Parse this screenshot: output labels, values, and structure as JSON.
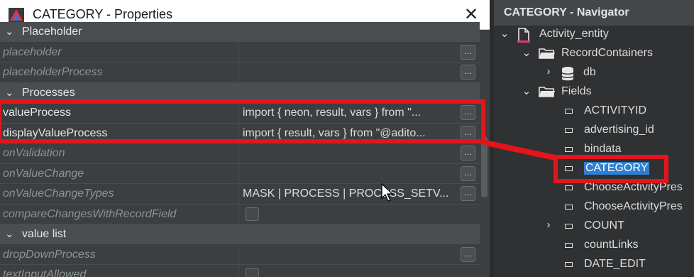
{
  "dialog": {
    "title": "CATEGORY - Properties",
    "close_glyph": "✕",
    "rows": [
      {
        "kind": "category",
        "label": "Placeholder",
        "expanded": true
      },
      {
        "kind": "prop",
        "name": "placeholder",
        "value": "",
        "button": true
      },
      {
        "kind": "prop",
        "name": "placeholderProcess",
        "value": "",
        "button": true
      },
      {
        "kind": "category",
        "label": "Processes",
        "expanded": true
      },
      {
        "kind": "prop",
        "name": "valueProcess",
        "value": "import { neon, result, vars } from \"...",
        "button": true,
        "set": true
      },
      {
        "kind": "prop",
        "name": "displayValueProcess",
        "value": "import { result, vars } from \"@adito...",
        "button": true,
        "set": true
      },
      {
        "kind": "prop",
        "name": "onValidation",
        "value": "",
        "button": true
      },
      {
        "kind": "prop",
        "name": "onValueChange",
        "value": "",
        "button": true
      },
      {
        "kind": "prop",
        "name": "onValueChangeTypes",
        "value": "MASK | PROCESS | PROCESS_SETV...",
        "button": true
      },
      {
        "kind": "prop",
        "name": "compareChangesWithRecordField",
        "value": "",
        "checkbox": true
      },
      {
        "kind": "category",
        "label": "value list",
        "expanded": true
      },
      {
        "kind": "prop",
        "name": "dropDownProcess",
        "value": "",
        "button": true
      },
      {
        "kind": "prop",
        "name": "textInputAllowed",
        "value": "",
        "checkbox": true
      }
    ],
    "button_label": "...",
    "icon_name": "app-logo-icon"
  },
  "navigator": {
    "title": "CATEGORY - Navigator",
    "nodes": [
      {
        "label": "Activity_entity",
        "level": 0,
        "twisty": "open",
        "icon": "entity-file-icon"
      },
      {
        "label": "RecordContainers",
        "level": 1,
        "twisty": "open",
        "icon": "folder-icon"
      },
      {
        "label": "db",
        "level": 2,
        "twisty": "closed",
        "icon": "database-icon"
      },
      {
        "label": "Fields",
        "level": 1,
        "twisty": "open",
        "icon": "folder-icon"
      },
      {
        "label": "ACTIVITYID",
        "level": 2,
        "twisty": "none",
        "icon": "field-icon"
      },
      {
        "label": "advertising_id",
        "level": 2,
        "twisty": "none",
        "icon": "field-icon"
      },
      {
        "label": "bindata",
        "level": 2,
        "twisty": "none",
        "icon": "field-icon"
      },
      {
        "label": "CATEGORY",
        "level": 2,
        "twisty": "none",
        "icon": "field-icon",
        "selected": true
      },
      {
        "label": "ChooseActivityPres",
        "level": 2,
        "twisty": "none",
        "icon": "field-icon"
      },
      {
        "label": "ChooseActivityPres",
        "level": 2,
        "twisty": "none",
        "icon": "field-icon"
      },
      {
        "label": "COUNT",
        "level": 2,
        "twisty": "closed",
        "icon": "field-icon"
      },
      {
        "label": "countLinks",
        "level": 2,
        "twisty": "none",
        "icon": "field-icon"
      },
      {
        "label": "DATE_EDIT",
        "level": 2,
        "twisty": "none",
        "icon": "field-icon"
      }
    ]
  },
  "colors": {
    "annotation_red": "#e3151b",
    "selection_blue": "#2f7fd0",
    "panel_bg": "#3c3f41"
  }
}
